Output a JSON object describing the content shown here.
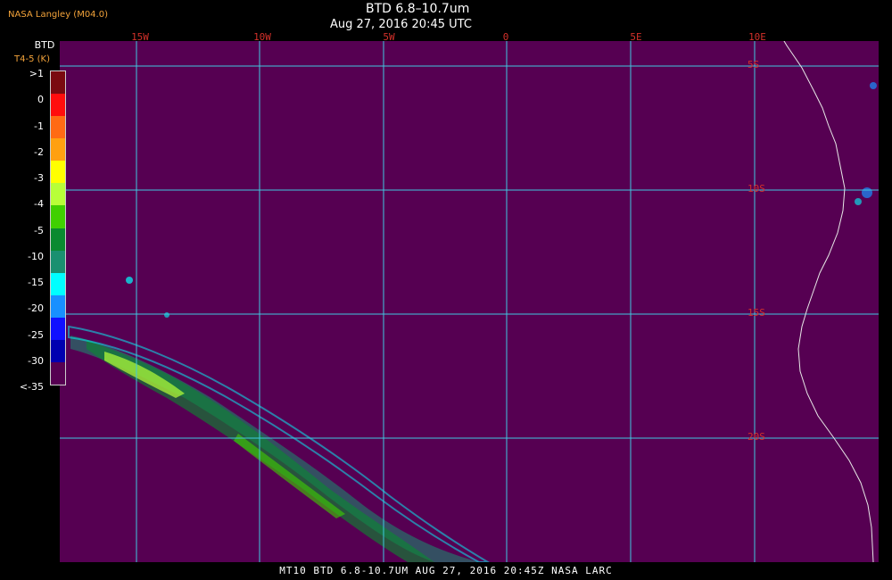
{
  "title": "BTD 6.8–10.7um",
  "subtitle": "Aug 27, 2016 20:45 UTC",
  "credit": "NASA Langley (M04.0)",
  "legend": {
    "title": "BTD",
    "units": "T4-5 (K)",
    "ticks": [
      ">1",
      "0",
      "-1",
      "-2",
      "-3",
      "-4",
      "-5",
      "-10",
      "-15",
      "-20",
      "-25",
      "-30",
      "<-35"
    ],
    "colors": [
      "#7a0a10",
      "#ff0d0d",
      "#ff6a14",
      "#ffa010",
      "#ffff00",
      "#b8ff38",
      "#40d000",
      "#0a8a30",
      "#1a9070",
      "#00ffff",
      "#1890ff",
      "#1010ff",
      "#0000b0",
      "#560052"
    ]
  },
  "lon_labels": [
    "15W",
    "10W",
    "5W",
    "0",
    "5E",
    "10E"
  ],
  "lat_labels": [
    "5S",
    "10S",
    "15S",
    "20S"
  ],
  "footer": "MT10  BTD 6.8-10.7UM  AUG 27, 2016 20:45Z  NASA LARC",
  "colors": {
    "background": "#560052",
    "grid": "#40c8e0",
    "coast": "#e8e8e8",
    "label": "#d2302a"
  }
}
